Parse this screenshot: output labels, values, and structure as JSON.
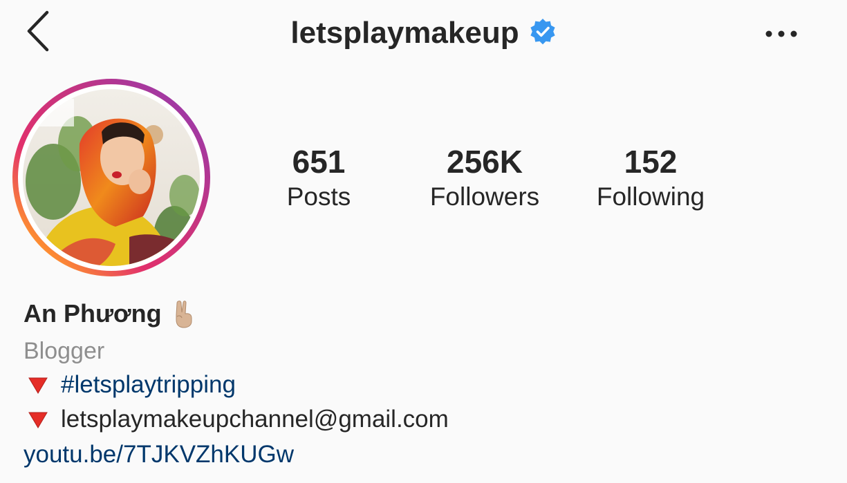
{
  "header": {
    "back_icon": "chevron-left-icon",
    "username": "letsplaymakeup",
    "verified_icon": "verified-badge-icon",
    "more_icon": "more-horizontal-icon"
  },
  "colors": {
    "verified": "#3897f0",
    "link": "#00376b",
    "text": "#262626",
    "muted": "#8e8e8e",
    "story_ring_start": "#c13584",
    "story_ring_end": "#fcaf45"
  },
  "stats": [
    {
      "value": "651",
      "label": "Posts"
    },
    {
      "value": "256K",
      "label": "Followers"
    },
    {
      "value": "152",
      "label": "Following"
    }
  ],
  "bio": {
    "name": "An Phương",
    "name_emoji": "victory-hand-icon",
    "category": "Blogger",
    "lines": [
      {
        "icon": "red-triangle-down-icon",
        "text": "#letsplaytripping"
      },
      {
        "icon": "red-triangle-down-icon",
        "text": "letsplaymakeupchannel@gmail.com"
      }
    ],
    "link": "youtu.be/7TJKVZhKUGw"
  }
}
